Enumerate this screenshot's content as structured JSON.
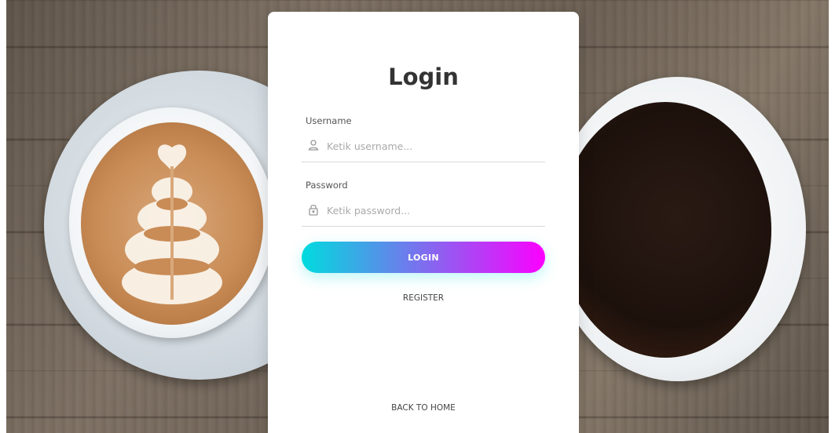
{
  "login_form": {
    "title": "Login",
    "username": {
      "label": "Username",
      "placeholder": "Ketik username...",
      "icon": "user-icon"
    },
    "password": {
      "label": "Password",
      "placeholder": "Ketik password...",
      "icon": "lock-icon"
    },
    "login_button": "LOGIN",
    "register_link": "REGISTER",
    "back_link": "BACK TO HOME"
  },
  "colors": {
    "gradient_start": "#00dbde",
    "gradient_end": "#fc00ff",
    "card": "#ffffff",
    "title": "#333333"
  }
}
